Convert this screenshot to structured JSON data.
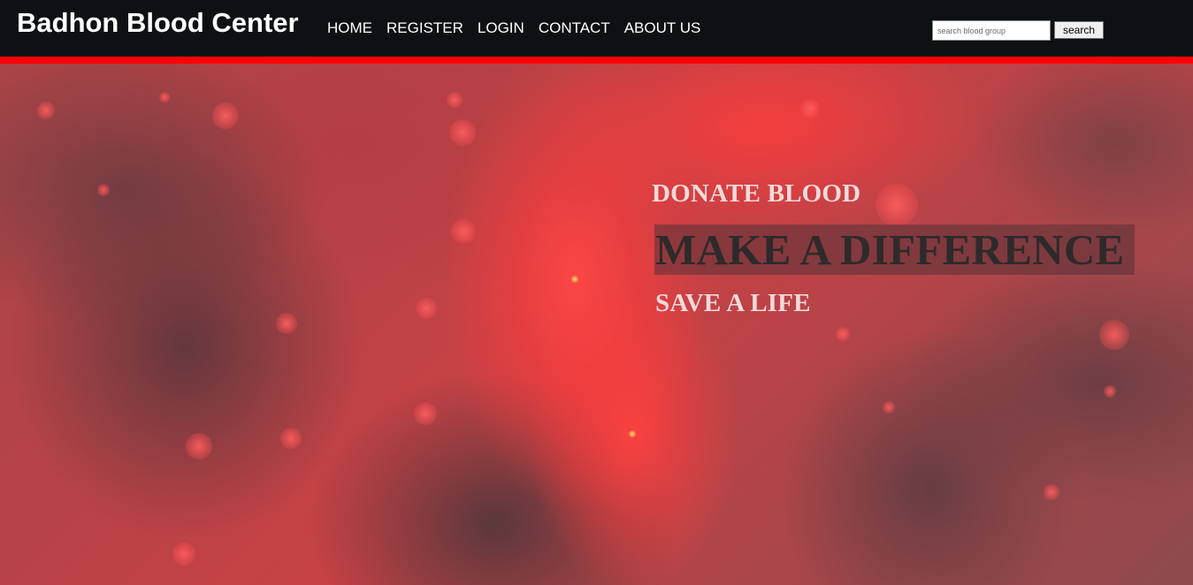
{
  "header": {
    "brand": "Badhon Blood Center",
    "nav": [
      {
        "label": "HOME"
      },
      {
        "label": "REGISTER"
      },
      {
        "label": "LOGIN"
      },
      {
        "label": "CONTACT"
      },
      {
        "label": "ABOUT US"
      }
    ],
    "search": {
      "placeholder": "search blood group",
      "value": "",
      "button_label": "search"
    }
  },
  "hero": {
    "line1": "DONATE BLOOD",
    "line2": "MAKE A DIFFERENCE",
    "line3": "SAVE A LIFE"
  },
  "colors": {
    "navbar_bg": "#0d1113",
    "accent_rule": "#ff0000",
    "hero_text": "#f3dada",
    "highlight_text": "#2e2a2b"
  }
}
